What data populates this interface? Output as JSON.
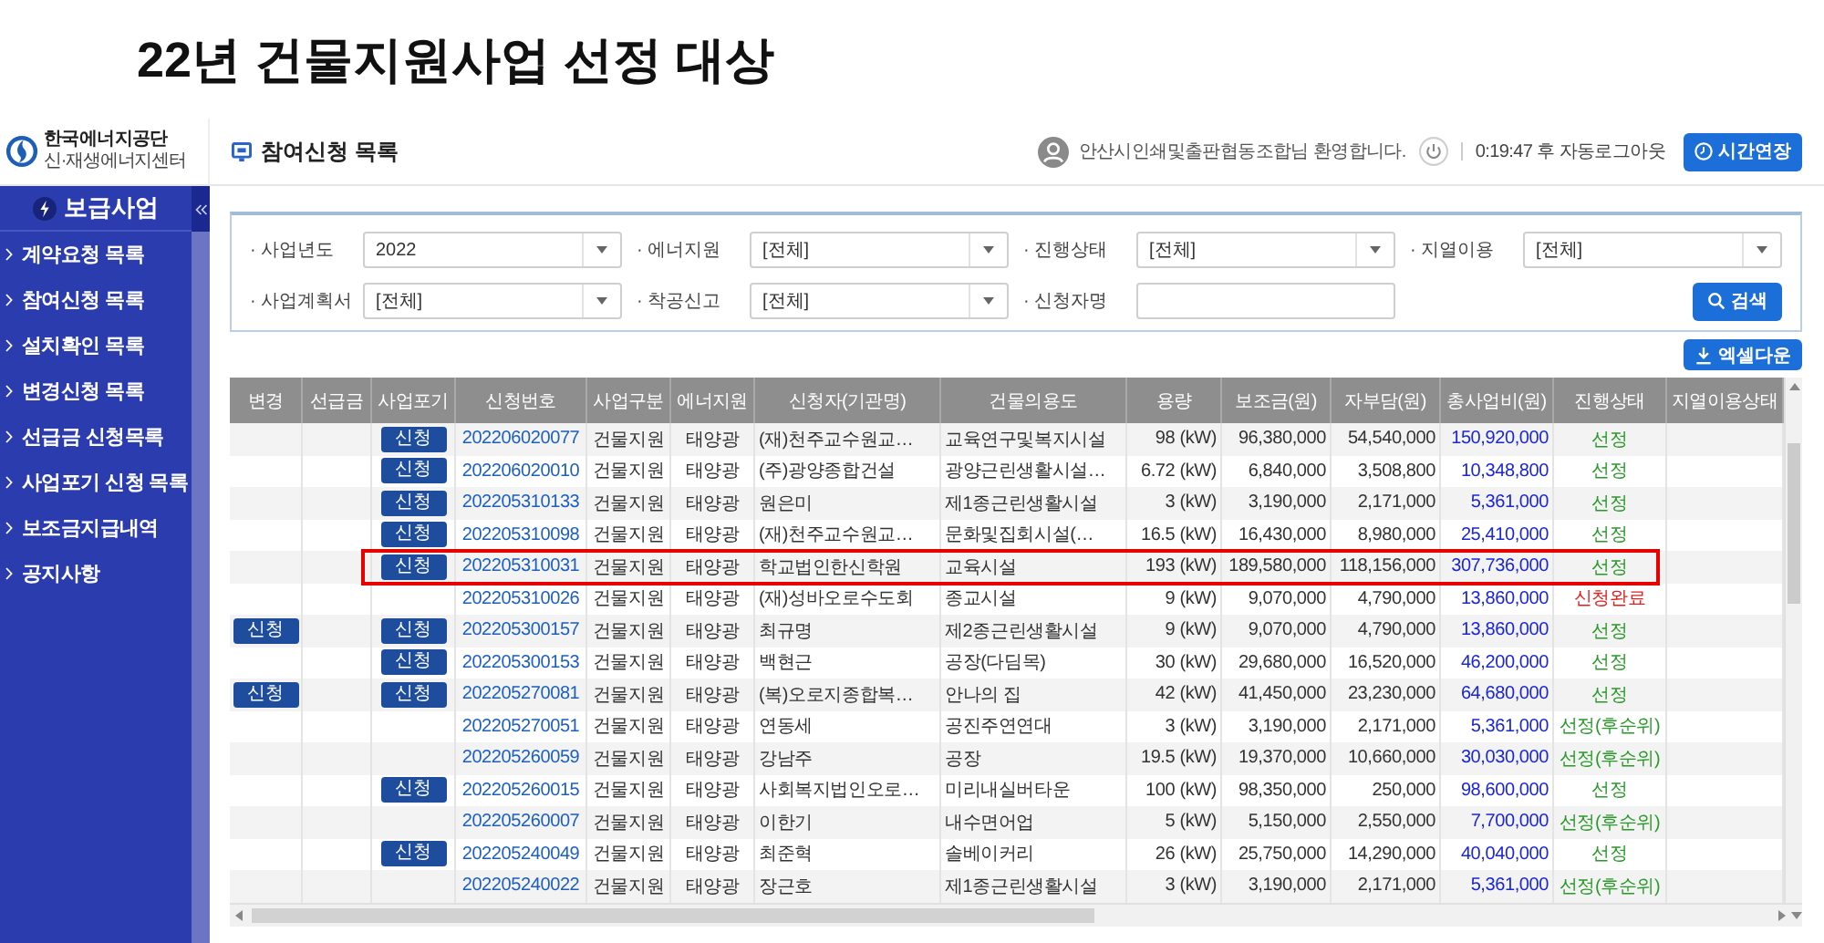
{
  "slide_title": "22년 건물지원사업 선정 대상",
  "header": {
    "logo_name": "한국에너지공단",
    "logo_subtitle": "신·재생에너지센터",
    "page_title": "참여신청 목록",
    "welcome": "안산시인쇄및출판협동조합님 환영합니다.",
    "logout_timer": "0:19:47 후 자동로그아웃",
    "extend_button": "시간연장"
  },
  "sidebar": {
    "title": "보급사업",
    "items": [
      {
        "label": "계약요청 목록"
      },
      {
        "label": "참여신청 목록"
      },
      {
        "label": "설치확인 목록"
      },
      {
        "label": "변경신청 목록"
      },
      {
        "label": "선급금 신청목록"
      },
      {
        "label": "사업포기 신청 목록"
      },
      {
        "label": "보조금지급내역"
      },
      {
        "label": "공지사항"
      }
    ]
  },
  "filters": [
    {
      "label": "· 사업년도",
      "kind": "select",
      "value": "2022"
    },
    {
      "label": "· 에너지원",
      "kind": "select",
      "value": "[전체]"
    },
    {
      "label": "· 진행상태",
      "kind": "select",
      "value": "[전체]"
    },
    {
      "label": "· 지열이용",
      "kind": "select",
      "value": "[전체]"
    },
    {
      "label": "· 사업계획서",
      "kind": "select",
      "value": "[전체]"
    },
    {
      "label": "· 착공신고",
      "kind": "select",
      "value": "[전체]"
    },
    {
      "label": "· 신청자명",
      "kind": "text"
    }
  ],
  "search_button": "검색",
  "excel_button": "엑셀다운",
  "table": {
    "columns": [
      "변경",
      "선급금",
      "사업포기",
      "신청번호",
      "사업구분",
      "에너지원",
      "신청자(기관명)",
      "건물의용도",
      "용량",
      "보조금(원)",
      "자부담(원)",
      "총사업비(원)",
      "진행상태",
      "지열이용상태"
    ],
    "rows": [
      {
        "withdraw_button": "신청",
        "number": "202206020077",
        "category": "건물지원",
        "energy": "태양광",
        "applicant": "(재)천주교수원교…",
        "usage": "교육연구및복지시설",
        "capacity": "98 (kW)",
        "subsidy": "96,380,000",
        "self_pay": "54,540,000",
        "total": "150,920,000",
        "status": {
          "text": "선정",
          "color": "#2a9a2a"
        },
        "highlighted": false
      },
      {
        "withdraw_button": "신청",
        "number": "202206020010",
        "category": "건물지원",
        "energy": "태양광",
        "applicant": "(주)광양종합건설",
        "usage": "광양근린생활시설…",
        "capacity": "6.72 (kW)",
        "subsidy": "6,840,000",
        "self_pay": "3,508,800",
        "total": "10,348,800",
        "status": {
          "text": "선정",
          "color": "#2a9a2a"
        },
        "highlighted": false
      },
      {
        "withdraw_button": "신청",
        "number": "202205310133",
        "category": "건물지원",
        "energy": "태양광",
        "applicant": "원은미",
        "usage": "제1종근린생활시설",
        "capacity": "3 (kW)",
        "subsidy": "3,190,000",
        "self_pay": "2,171,000",
        "total": "5,361,000",
        "status": {
          "text": "선정",
          "color": "#2a9a2a"
        },
        "highlighted": false
      },
      {
        "withdraw_button": "신청",
        "number": "202205310098",
        "category": "건물지원",
        "energy": "태양광",
        "applicant": "(재)천주교수원교…",
        "usage": "문화및집회시설(…",
        "capacity": "16.5 (kW)",
        "subsidy": "16,430,000",
        "self_pay": "8,980,000",
        "total": "25,410,000",
        "status": {
          "text": "선정",
          "color": "#2a9a2a"
        },
        "highlighted": false
      },
      {
        "withdraw_button": "신청",
        "number": "202205310031",
        "category": "건물지원",
        "energy": "태양광",
        "applicant": "학교법인한신학원",
        "usage": "교육시설",
        "capacity": "193 (kW)",
        "subsidy": "189,580,000",
        "self_pay": "118,156,000",
        "total": "307,736,000",
        "status": {
          "text": "선정",
          "color": "#2a9a2a"
        },
        "highlighted": true
      },
      {
        "number": "202205310026",
        "category": "건물지원",
        "energy": "태양광",
        "applicant": "(재)성바오로수도회",
        "usage": "종교시설",
        "capacity": "9 (kW)",
        "subsidy": "9,070,000",
        "self_pay": "4,790,000",
        "total": "13,860,000",
        "status": {
          "text": "신청완료",
          "color": "#e02020"
        },
        "highlighted": false
      },
      {
        "change_button": "신청",
        "withdraw_button": "신청",
        "number": "202205300157",
        "category": "건물지원",
        "energy": "태양광",
        "applicant": "최규명",
        "usage": "제2종근린생활시설",
        "capacity": "9 (kW)",
        "subsidy": "9,070,000",
        "self_pay": "4,790,000",
        "total": "13,860,000",
        "status": {
          "text": "선정",
          "color": "#2a9a2a"
        },
        "highlighted": false
      },
      {
        "withdraw_button": "신청",
        "number": "202205300153",
        "category": "건물지원",
        "energy": "태양광",
        "applicant": "백현근",
        "usage": "공장(다딤목)",
        "capacity": "30 (kW)",
        "subsidy": "29,680,000",
        "self_pay": "16,520,000",
        "total": "46,200,000",
        "status": {
          "text": "선정",
          "color": "#2a9a2a"
        },
        "highlighted": false
      },
      {
        "change_button": "신청",
        "withdraw_button": "신청",
        "number": "202205270081",
        "category": "건물지원",
        "energy": "태양광",
        "applicant": "(복)오로지종합복…",
        "usage": "안나의 집",
        "capacity": "42 (kW)",
        "subsidy": "41,450,000",
        "self_pay": "23,230,000",
        "total": "64,680,000",
        "status": {
          "text": "선정",
          "color": "#2a9a2a"
        },
        "highlighted": false
      },
      {
        "number": "202205270051",
        "category": "건물지원",
        "energy": "태양광",
        "applicant": "연동세",
        "usage": "공진주연연대",
        "capacity": "3 (kW)",
        "subsidy": "3,190,000",
        "self_pay": "2,171,000",
        "total": "5,361,000",
        "status": {
          "text": "선정(후순위)",
          "color": "#2a9a2a"
        },
        "highlighted": false
      },
      {
        "number": "202205260059",
        "category": "건물지원",
        "energy": "태양광",
        "applicant": "강남주",
        "usage": "공장",
        "capacity": "19.5 (kW)",
        "subsidy": "19,370,000",
        "self_pay": "10,660,000",
        "total": "30,030,000",
        "status": {
          "text": "선정(후순위)",
          "color": "#2a9a2a"
        },
        "highlighted": false
      },
      {
        "withdraw_button": "신청",
        "number": "202205260015",
        "category": "건물지원",
        "energy": "태양광",
        "applicant": "사회복지법인오로…",
        "usage": "미리내실버타운",
        "capacity": "100 (kW)",
        "subsidy": "98,350,000",
        "self_pay": "250,000",
        "total": "98,600,000",
        "status": {
          "text": "선정",
          "color": "#2a9a2a"
        },
        "highlighted": false
      },
      {
        "number": "202205260007",
        "category": "건물지원",
        "energy": "태양광",
        "applicant": "이한기",
        "usage": "내수면어업",
        "capacity": "5 (kW)",
        "subsidy": "5,150,000",
        "self_pay": "2,550,000",
        "total": "7,700,000",
        "status": {
          "text": "선정(후순위)",
          "color": "#2a9a2a"
        },
        "highlighted": false
      },
      {
        "withdraw_button": "신청",
        "number": "202205240049",
        "category": "건물지원",
        "energy": "태양광",
        "applicant": "최준혁",
        "usage": "솔베이커리",
        "capacity": "26 (kW)",
        "subsidy": "25,750,000",
        "self_pay": "14,290,000",
        "total": "40,040,000",
        "status": {
          "text": "선정",
          "color": "#2a9a2a"
        },
        "highlighted": false
      },
      {
        "number": "202205240022",
        "category": "건물지원",
        "energy": "태양광",
        "applicant": "장근호",
        "usage": "제1종근린생활시설",
        "capacity": "3 (kW)",
        "subsidy": "3,190,000",
        "self_pay": "2,171,000",
        "total": "5,361,000",
        "status": {
          "text": "선정(후순위)",
          "color": "#2a9a2a"
        },
        "highlighted": false
      }
    ]
  }
}
